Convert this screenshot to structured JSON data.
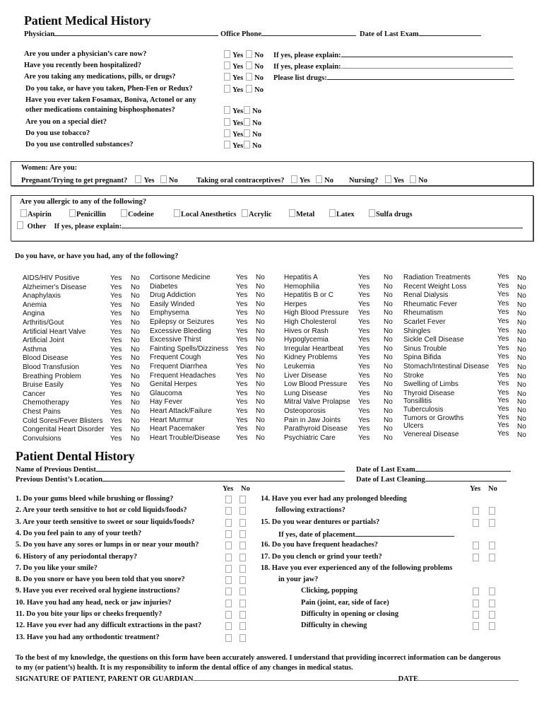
{
  "medical": {
    "title": "Patient Medical History",
    "header_fields": {
      "physician": "Physician",
      "office_phone": "Office Phone",
      "date_last_exam": "Date of Last Exam"
    },
    "questions": [
      {
        "text": "Are you under a physician’s care now?",
        "yes": "Yes",
        "no": "No",
        "followup": "If yes, please explain:"
      },
      {
        "text": "Have you recently been hospitalized?",
        "yes": "Yes",
        "no": "No",
        "followup": "If yes, please explain:"
      },
      {
        "text": "Are  you taking any medications, pills, or drugs?",
        "yes": "Yes",
        "no": "No",
        "followup": "Please list drugs:"
      },
      {
        "text": "Do you take, or have you taken, Phen-Fen or Redux?",
        "yes": "Yes",
        "no": "No",
        "followup": ""
      },
      {
        "text": "Have you ever taken Fosamax, Boniva, Actonel or any",
        "yes": "",
        "no": "",
        "followup": ""
      },
      {
        "text": "other medications containing bisphosphonates?",
        "yes": "Yes",
        "no": "No",
        "followup": ""
      },
      {
        "text": "Are you on a special diet?",
        "yes": "Yes",
        "no": "No",
        "followup": ""
      },
      {
        "text": "Do you use tobacco?",
        "yes": "Yes",
        "no": "No",
        "followup": ""
      },
      {
        "text": "Do you use controlled substances?",
        "yes": "Yes",
        "no": "No",
        "followup": ""
      }
    ],
    "women": {
      "heading": "Women:  Are you:",
      "pregnant": "Pregnant/Trying to get pregnant?",
      "contraceptives": "Taking oral contraceptives?",
      "nursing": "Nursing?",
      "yes": "Yes",
      "no": "No"
    },
    "allergies": {
      "heading": "Are you allergic to any of the following?",
      "items": [
        "Aspirin",
        "Penicillin",
        "Codeine",
        "Local Anesthetics",
        "Acrylic",
        "Metal",
        "Latex",
        "Sulfa drugs"
      ],
      "other": "Other",
      "explain": "If yes, please explain:"
    },
    "conditions_heading": "Do you have, or have you had, any of the following?",
    "yes": "Yes",
    "no": "No",
    "conditions": [
      [
        "AIDS/HIV Positive",
        "Alzheimer's Disease",
        "Anaphylaxis",
        "Anemia",
        "Angina",
        "Arthritis/Gout",
        "Artificial Heart Valve",
        "Artificial Joint",
        "Asthma",
        "Blood Disease",
        "Blood Transfusion",
        "Breathing Problem",
        "Bruise Easily",
        "Cancer",
        "Chemotherapy",
        "Chest Pains",
        "Cold Sores/Fever Blisters",
        "Congenital Heart Disorder",
        "Convulsions"
      ],
      [
        "Cortisone Medicine",
        "Diabetes",
        "Drug Addiction",
        "Easily Winded",
        "Emphysema",
        "Epilepsy or Seizures",
        "Excessive Bleeding",
        "Excessive Thirst",
        "Fainting Spells/Dizziness",
        "Frequent Cough",
        "Frequent Diarrhea",
        "Frequent Headaches",
        "Genital Herpes",
        "Glaucoma",
        "Hay Fever",
        "Heart Attack/Failure",
        "Heart Murmur",
        "Heart Pacemaker",
        "Heart Trouble/Disease"
      ],
      [
        "Hepatitis A",
        "Hemophilia",
        "Hepatitis B or C",
        "Herpes",
        "High Blood Pressure",
        "High Cholesterol",
        "Hives or Rash",
        "Hypoglycemia",
        "Irregular Heartbeat",
        "Kidney Problems",
        "Leukemia",
        "Liver Disease",
        "Low Blood Pressure",
        "Lung Disease",
        "Mitral Valve Prolapse",
        "Osteoporosis",
        "Pain in Jaw Joints",
        "Parathyroid Disease",
        "Psychiatric Care"
      ],
      [
        "Radiation Treatments",
        "Recent Weight Loss",
        "Renal Dialysis",
        "Rheumatic Fever",
        "Rheumatism",
        "Scarlet Fever",
        "Shingles",
        "Sickle Cell Disease",
        "Sinus Trouble",
        "Spina Bifida",
        "Stomach/Intestinal Disease",
        "Stroke",
        "Swelling of Limbs",
        "Thyroid Disease",
        "Tonsillitis",
        "Tuberculosis",
        "Tumors or Growths",
        "Ulcers",
        "Venereal Disease"
      ]
    ]
  },
  "dental": {
    "title": "Patient Dental History",
    "fields": {
      "previous_dentist": "Name of Previous Dentist",
      "dentist_location": "Previous Dentist’s Location",
      "date_last_exam": "Date of Last Exam",
      "date_last_cleaning": "Date of Last Cleaning"
    },
    "yes": "Yes",
    "no": "No",
    "left_questions": [
      "1.  Do your gums bleed while brushing or flossing?",
      "2.  Are your teeth sensitive to hot or cold liquids/foods?",
      "3.   Are your teeth sensitive to sweet or sour liquids/foods?",
      "4.  Do you feel pain to any of your teeth?",
      "5.  Do you have any sores or lumps in or near your mouth?",
      "6.  History of any periodontal therapy?",
      "7.  Do you like your smile?",
      "8.  Do you snore or have you been told that you snore?",
      "9.  Have you ever received oral hygiene instructions?",
      "10. Have you had any head, neck or jaw injuries?",
      "11.  Do you bite your lips or cheeks frequently?",
      "12.  Have you ever had any difficult extractions in the past?",
      "13. Have you had any orthodontic treatment?"
    ],
    "right_questions": [
      {
        "text": "14. Have you ever had any prolonged bleeding",
        "indent": 0,
        "checks": false
      },
      {
        "text": "following extractions?",
        "indent": 1,
        "checks": true
      },
      {
        "text": "15. Do you wear dentures or partials?",
        "indent": 0,
        "checks": true
      },
      {
        "text": "If yes, date of placement",
        "indent": 1,
        "checks": false,
        "line": true
      },
      {
        "text": "16.  Do you have frequent headaches?",
        "indent": 0,
        "checks": true
      },
      {
        "text": "17.  Do you clench or grind your teeth?",
        "indent": 0,
        "checks": true
      },
      {
        "text": "18.  Have you ever experienced any of the following problems",
        "indent": 0,
        "checks": false
      },
      {
        "text": "in your jaw?",
        "indent": 1,
        "checks": false
      },
      {
        "text": "Clicking, popping",
        "indent": 2,
        "checks": true
      },
      {
        "text": "Pain (joint, ear, side of face)",
        "indent": 2,
        "checks": true
      },
      {
        "text": "Difficulty in opening or closing",
        "indent": 2,
        "checks": true
      },
      {
        "text": "Difficulty in chewing",
        "indent": 2,
        "checks": true
      }
    ]
  },
  "footer": {
    "statement_line1": "To the best of my knowledge, the questions on this form have been accurately answered.  I understand that providing incorrect information can be dangerous",
    "statement_line2": "to my (or patient’s) health. It is my responsibility to inform the dental office of any changes in medical status.",
    "signature_label": "SIGNATURE OF PATIENT, PARENT OR GUARDIAN",
    "date_label": "DATE"
  }
}
